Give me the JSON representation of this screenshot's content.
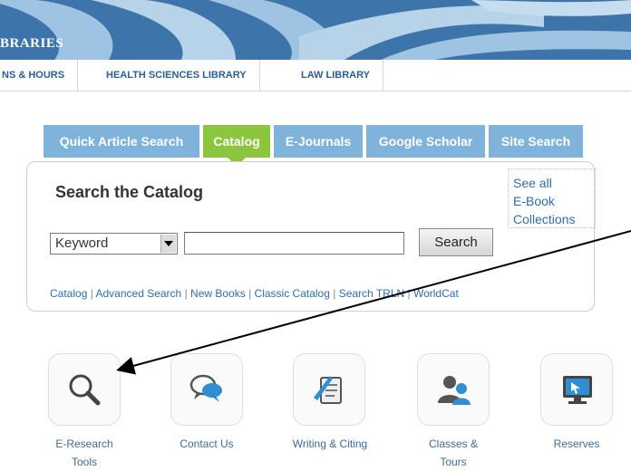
{
  "banner": {
    "title": "BRARIES"
  },
  "nav": {
    "items": [
      {
        "label": "NS & HOURS"
      },
      {
        "label": "HEALTH SCIENCES LIBRARY"
      },
      {
        "label": "LAW LIBRARY"
      }
    ]
  },
  "tabs": [
    {
      "label": "Quick Article Search"
    },
    {
      "label": "Catalog"
    },
    {
      "label": "E-Journals"
    },
    {
      "label": "Google Scholar"
    },
    {
      "label": "Site Search"
    }
  ],
  "panel": {
    "title": "Search the Catalog",
    "ebook_line1": "See all",
    "ebook_line2": "E-Book",
    "ebook_line3": "Collections",
    "select_value": "Keyword",
    "search_value": "",
    "search_button": "Search",
    "links": [
      "Catalog",
      "Advanced Search",
      "New Books",
      "Classic Catalog",
      "Search TRLN",
      "WorldCat"
    ]
  },
  "tiles": [
    {
      "label_1": "E-Research",
      "label_2": "Tools",
      "icon": "magnifier-icon"
    },
    {
      "label_1": "Contact Us",
      "icon": "speech-bubbles-icon"
    },
    {
      "label_1": "Writing & Citing",
      "icon": "quill-scroll-icon"
    },
    {
      "label_1": "Classes &",
      "label_2": "Tours",
      "icon": "people-icon"
    },
    {
      "label_1": "Reserves",
      "icon": "monitor-icon"
    }
  ],
  "colors": {
    "tab_inactive": "#7fb3da",
    "tab_active": "#8cc63e",
    "link": "#2f6ea8",
    "banner": "#3a6fa3"
  }
}
